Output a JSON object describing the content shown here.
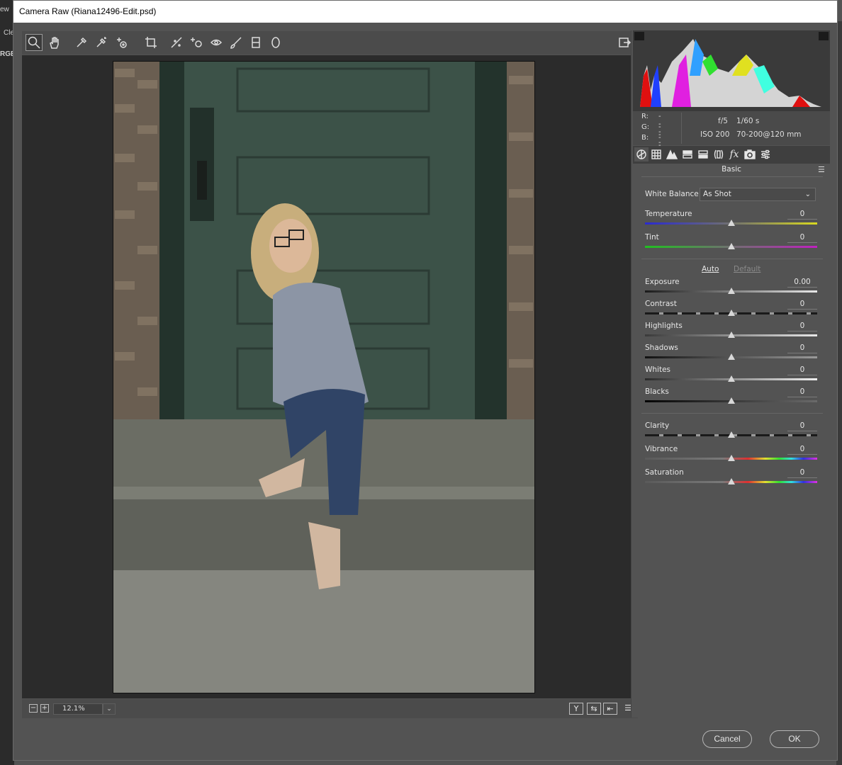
{
  "background_app": {
    "text_1": "ew",
    "text_2": "Cle",
    "text_3": "RGE"
  },
  "window": {
    "title": "Camera Raw (Riana12496-Edit.psd)"
  },
  "toolbar": {
    "tools": [
      "zoom-tool",
      "hand-tool",
      "white-balance-tool",
      "color-sampler-tool",
      "targeted-adjustment-tool",
      "crop-tool",
      "straighten-tool",
      "spot-removal-tool",
      "red-eye-tool",
      "adjustment-brush",
      "graduated-filter",
      "radial-filter"
    ],
    "open_preferences_icon": "preferences-icon"
  },
  "zoom": {
    "value": "12.1%",
    "minus": "−",
    "plus": "+"
  },
  "view_buttons": {
    "y": "Y",
    "swap": "⇆",
    "copy": "⇤",
    "settings": "☰"
  },
  "histogram_meta": {
    "r_label": "R:",
    "r_value": "---",
    "g_label": "G:",
    "g_value": "---",
    "b_label": "B:",
    "b_value": "---",
    "aperture": "f/5",
    "shutter": "1/60 s",
    "iso": "ISO 200",
    "lens": "70-200@120 mm"
  },
  "panel": {
    "title": "Basic",
    "tabs": [
      "basic-icon",
      "tone-curve-icon",
      "detail-icon",
      "hsl-icon",
      "split-toning-icon",
      "lens-icon",
      "fx-icon",
      "camera-calibration-icon",
      "presets-icon"
    ],
    "white_balance_label": "White Balance:",
    "white_balance_value": "As Shot",
    "auto_label": "Auto",
    "default_label": "Default",
    "sliders": [
      {
        "label": "Temperature",
        "value": "0"
      },
      {
        "label": "Tint",
        "value": "0"
      },
      {
        "label": "Exposure",
        "value": "0.00"
      },
      {
        "label": "Contrast",
        "value": "0"
      },
      {
        "label": "Highlights",
        "value": "0"
      },
      {
        "label": "Shadows",
        "value": "0"
      },
      {
        "label": "Whites",
        "value": "0"
      },
      {
        "label": "Blacks",
        "value": "0"
      },
      {
        "label": "Clarity",
        "value": "0"
      },
      {
        "label": "Vibrance",
        "value": "0"
      },
      {
        "label": "Saturation",
        "value": "0"
      }
    ],
    "slider_position_fraction": 0.5
  },
  "dialog_buttons": {
    "cancel": "Cancel",
    "ok": "OK"
  },
  "colors": {
    "accent": "#535353",
    "track_dark": "#2c2c2c",
    "thumb": "#d8d8d8"
  }
}
